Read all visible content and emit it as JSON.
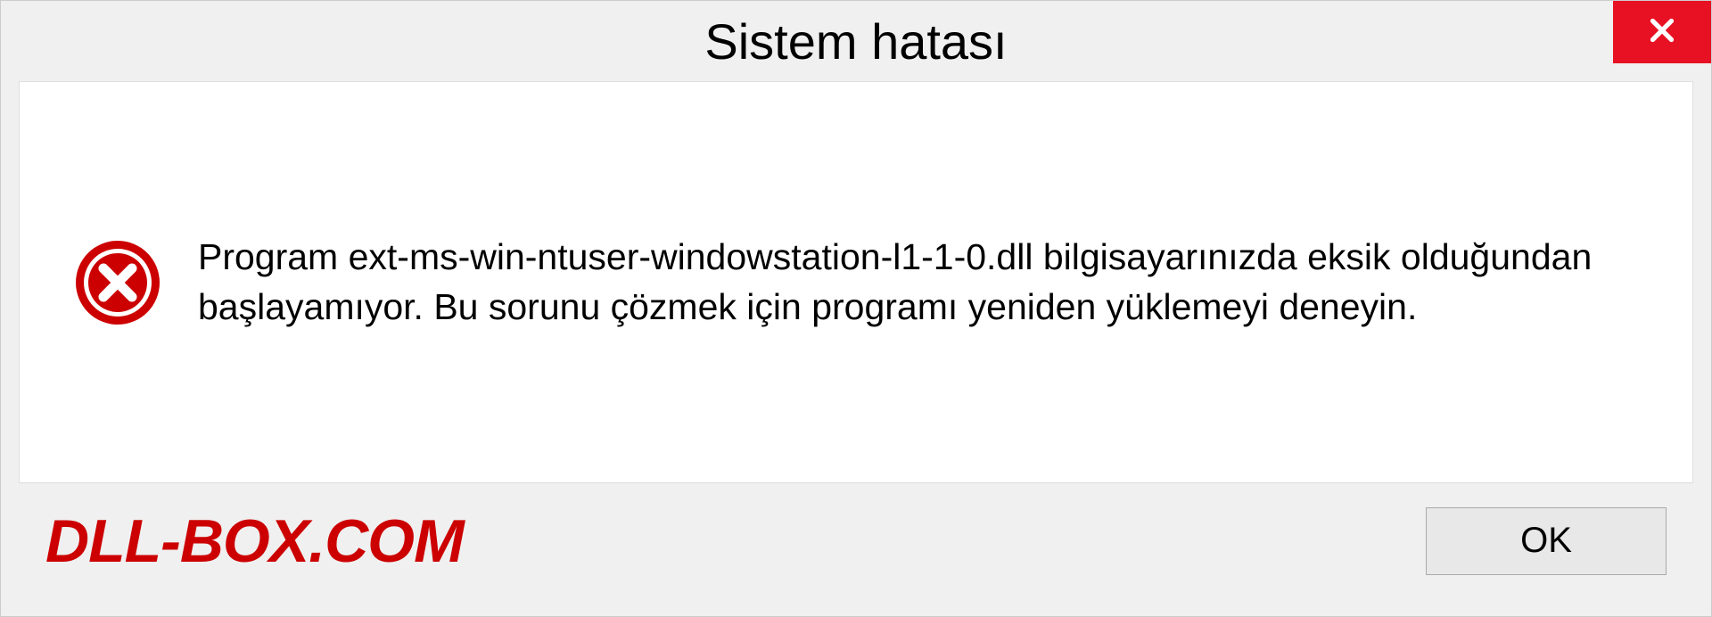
{
  "titlebar": {
    "title": "Sistem hatası"
  },
  "content": {
    "message": "Program ext-ms-win-ntuser-windowstation-l1-1-0.dll bilgisayarınızda eksik olduğundan başlayamıyor. Bu sorunu çözmek için programı yeniden yüklemeyi deneyin."
  },
  "footer": {
    "watermark": "DLL-BOX.COM",
    "ok_label": "OK"
  }
}
